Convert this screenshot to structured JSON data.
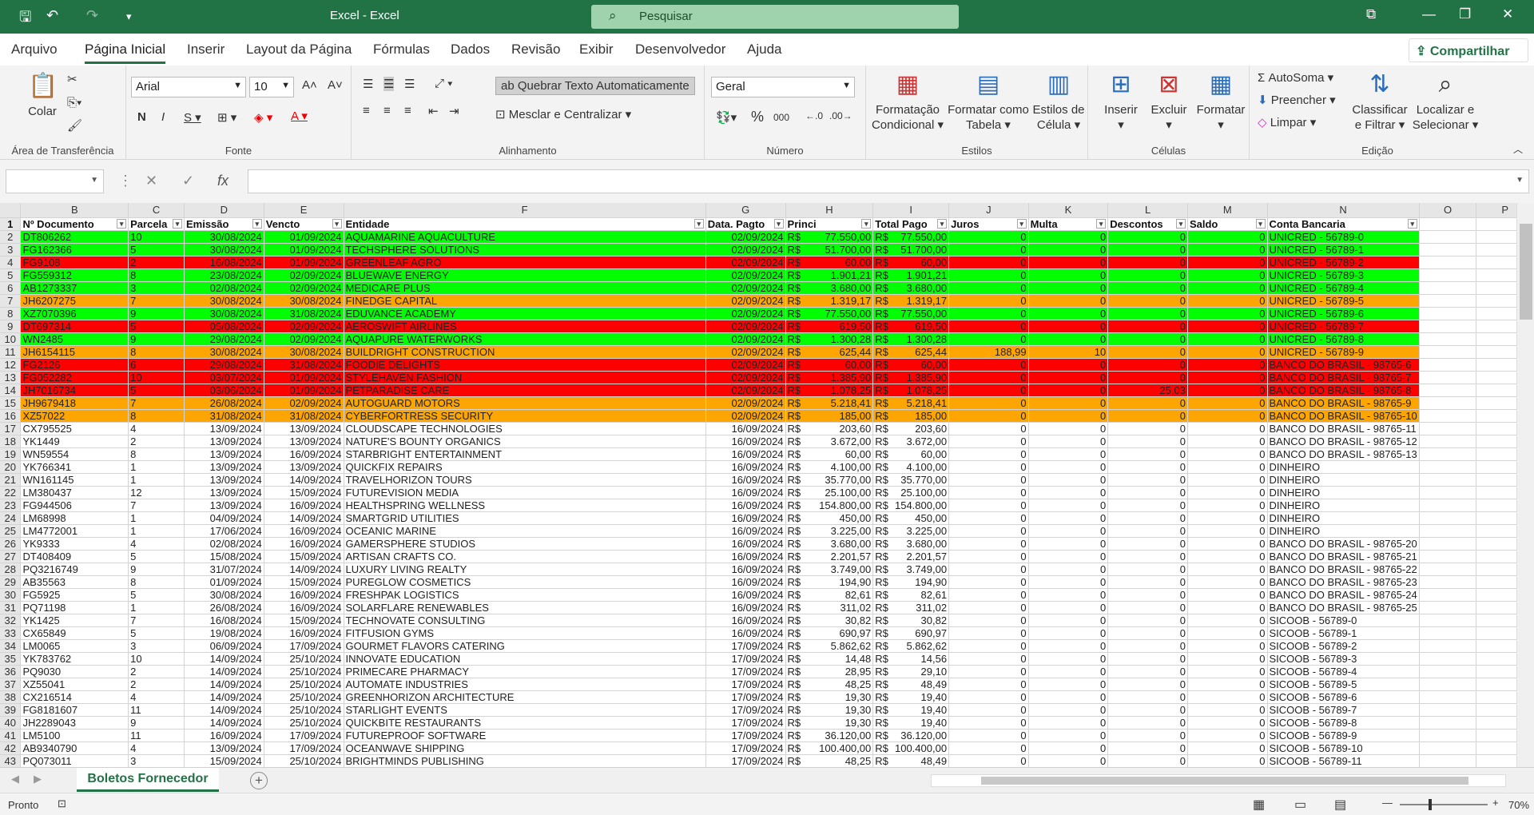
{
  "titlebar": {
    "title": "Excel  -  Excel",
    "search_placeholder": "Pesquisar"
  },
  "menu": {
    "tabs": [
      "Arquivo",
      "Página Inicial",
      "Inserir",
      "Layout da Página",
      "Fórmulas",
      "Dados",
      "Revisão",
      "Exibir",
      "Desenvolvedor",
      "Ajuda"
    ],
    "share": "Compartilhar"
  },
  "ribbon": {
    "clipboard": {
      "label": "Área de Transferência",
      "paste": "Colar"
    },
    "font": {
      "label": "Fonte",
      "name": "Arial",
      "size": "10"
    },
    "alignment": {
      "label": "Alinhamento",
      "wrap": "Quebrar Texto Automaticamente",
      "merge": "Mesclar e Centralizar"
    },
    "number": {
      "label": "Número",
      "format": "Geral"
    },
    "styles": {
      "label": "Estilos",
      "cond1": "Formatação",
      "cond2": "Condicional",
      "table1": "Formatar como",
      "table2": "Tabela",
      "cell1": "Estilos de",
      "cell2": "Célula"
    },
    "cells": {
      "label": "Células",
      "insert": "Inserir",
      "delete": "Excluir",
      "format": "Formatar"
    },
    "editing": {
      "label": "Edição",
      "autosum": "AutoSoma",
      "fill": "Preencher",
      "clear": "Limpar",
      "sort1": "Classificar",
      "sort2": "e Filtrar",
      "find1": "Localizar e",
      "find2": "Selecionar"
    }
  },
  "grid": {
    "columns": [
      "",
      "B",
      "C",
      "D",
      "E",
      "F",
      "G",
      "H",
      "I",
      "J",
      "K",
      "L",
      "M",
      "N",
      "O",
      "P"
    ],
    "headers": [
      "Nº Documento",
      "Parcela",
      "Emissão",
      "Vencto",
      "Entidade",
      "Data. Pagto",
      "Princi",
      "Total Pago",
      "Juros",
      "Multa",
      "Descontos",
      "Saldo",
      "Conta Bancaria",
      "",
      ""
    ],
    "rows": [
      {
        "n": "2",
        "c": "green",
        "d": [
          "DT806262",
          "10",
          "30/08/2024",
          "01/09/2024",
          "AQUAMARINE AQUACULTURE",
          "02/09/2024",
          "77.550,00",
          "77.550,00",
          "0",
          "0",
          "0",
          "0",
          "UNICRED - 56789-0"
        ]
      },
      {
        "n": "3",
        "c": "green",
        "d": [
          "FG162366",
          "5",
          "30/08/2024",
          "01/09/2024",
          "TECHSPHERE SOLUTIONS",
          "02/09/2024",
          "51.700,00",
          "51.700,00",
          "0",
          "0",
          "0",
          "0",
          "UNICRED - 56789-1"
        ]
      },
      {
        "n": "4",
        "c": "red",
        "d": [
          "FG9108",
          "2",
          "16/08/2024",
          "01/09/2024",
          "GREENLEAF AGRO",
          "02/09/2024",
          "60,00",
          "60,00",
          "0",
          "0",
          "0",
          "0",
          "UNICRED - 56789-2"
        ]
      },
      {
        "n": "5",
        "c": "green",
        "d": [
          "FG559312",
          "8",
          "23/08/2024",
          "02/09/2024",
          "BLUEWAVE ENERGY",
          "02/09/2024",
          "1.901,21",
          "1.901,21",
          "0",
          "0",
          "0",
          "0",
          "UNICRED - 56789-3"
        ]
      },
      {
        "n": "6",
        "c": "green",
        "d": [
          "AB1273337",
          "3",
          "02/08/2024",
          "02/09/2024",
          "MEDICARE PLUS",
          "02/09/2024",
          "3.680,00",
          "3.680,00",
          "0",
          "0",
          "0",
          "0",
          "UNICRED - 56789-4"
        ]
      },
      {
        "n": "7",
        "c": "orange",
        "d": [
          "JH6207275",
          "7",
          "30/08/2024",
          "30/08/2024",
          "FINEDGE CAPITAL",
          "02/09/2024",
          "1.319,17",
          "1.319,17",
          "0",
          "0",
          "0",
          "0",
          "UNICRED - 56789-5"
        ]
      },
      {
        "n": "8",
        "c": "green",
        "d": [
          "XZ7070396",
          "9",
          "30/08/2024",
          "31/08/2024",
          "EDUVANCE ACADEMY",
          "02/09/2024",
          "77.550,00",
          "77.550,00",
          "0",
          "0",
          "0",
          "0",
          "UNICRED - 56789-6"
        ]
      },
      {
        "n": "9",
        "c": "red",
        "d": [
          "DT697314",
          "5",
          "05/08/2024",
          "02/09/2024",
          "AEROSWIFT AIRLINES",
          "02/09/2024",
          "619,50",
          "619,50",
          "0",
          "0",
          "0",
          "0",
          "UNICRED - 56789-7"
        ]
      },
      {
        "n": "10",
        "c": "green",
        "d": [
          "WN2485",
          "9",
          "29/08/2024",
          "02/09/2024",
          "AQUAPURE WATERWORKS",
          "02/09/2024",
          "1.300,28",
          "1.300,28",
          "0",
          "0",
          "0",
          "0",
          "UNICRED - 56789-8"
        ]
      },
      {
        "n": "11",
        "c": "orange",
        "d": [
          "JH6154115",
          "8",
          "30/08/2024",
          "30/08/2024",
          "BUILDRIGHT CONSTRUCTION",
          "02/09/2024",
          "625,44",
          "625,44",
          "188,99",
          "10",
          "0",
          "0",
          "UNICRED - 56789-9"
        ]
      },
      {
        "n": "12",
        "c": "red",
        "d": [
          "FG2126",
          "6",
          "29/08/2024",
          "31/08/2024",
          "FOODIE DELIGHTS",
          "02/09/2024",
          "60,00",
          "60,00",
          "0",
          "0",
          "0",
          "0",
          "BANCO DO BRASIL - 98765-6"
        ]
      },
      {
        "n": "13",
        "c": "red",
        "d": [
          "FG052282",
          "10",
          "03/07/2024",
          "01/09/2024",
          "STYLEHAVEN FASHION",
          "02/09/2024",
          "1.385,90",
          "1.385,90",
          "0",
          "0",
          "0",
          "0",
          "BANCO DO BRASIL - 98765-7"
        ]
      },
      {
        "n": "14",
        "c": "red",
        "d": [
          "JH7016734",
          "5",
          "03/06/2024",
          "01/09/2024",
          "PETPARADISE CARE",
          "02/09/2024",
          "1.078,25",
          "1.078,25",
          "0",
          "0",
          "25,03",
          "0",
          "BANCO DO BRASIL - 98765-8"
        ]
      },
      {
        "n": "15",
        "c": "orange",
        "d": [
          "JH9679418",
          "7",
          "26/08/2024",
          "02/09/2024",
          "AUTOGUARD MOTORS",
          "02/09/2024",
          "5.218,41",
          "5.218,41",
          "0",
          "0",
          "0",
          "0",
          "BANCO DO BRASIL - 98765-9"
        ]
      },
      {
        "n": "16",
        "c": "orange",
        "d": [
          "XZ57022",
          "8",
          "31/08/2024",
          "31/08/2024",
          "CYBERFORTRESS SECURITY",
          "02/09/2024",
          "185,00",
          "185,00",
          "0",
          "0",
          "0",
          "0",
          "BANCO DO BRASIL - 98765-10"
        ]
      },
      {
        "n": "17",
        "c": "",
        "d": [
          "CX795525",
          "4",
          "13/09/2024",
          "13/09/2024",
          "CLOUDSCAPE TECHNOLOGIES",
          "16/09/2024",
          "203,60",
          "203,60",
          "0",
          "0",
          "0",
          "0",
          "BANCO DO BRASIL - 98765-11"
        ]
      },
      {
        "n": "18",
        "c": "",
        "d": [
          "YK1449",
          "2",
          "13/09/2024",
          "13/09/2024",
          "NATURE'S BOUNTY ORGANICS",
          "16/09/2024",
          "3.672,00",
          "3.672,00",
          "0",
          "0",
          "0",
          "0",
          "BANCO DO BRASIL - 98765-12"
        ]
      },
      {
        "n": "19",
        "c": "",
        "d": [
          "WN59554",
          "8",
          "13/09/2024",
          "16/09/2024",
          "STARBRIGHT ENTERTAINMENT",
          "16/09/2024",
          "60,00",
          "60,00",
          "0",
          "0",
          "0",
          "0",
          "BANCO DO BRASIL - 98765-13"
        ]
      },
      {
        "n": "20",
        "c": "",
        "d": [
          "YK766341",
          "1",
          "13/09/2024",
          "13/09/2024",
          "QUICKFIX REPAIRS",
          "16/09/2024",
          "4.100,00",
          "4.100,00",
          "0",
          "0",
          "0",
          "0",
          "DINHEIRO"
        ]
      },
      {
        "n": "21",
        "c": "",
        "d": [
          "WN161145",
          "1",
          "13/09/2024",
          "14/09/2024",
          "TRAVELHORIZON TOURS",
          "16/09/2024",
          "35.770,00",
          "35.770,00",
          "0",
          "0",
          "0",
          "0",
          "DINHEIRO"
        ]
      },
      {
        "n": "22",
        "c": "",
        "d": [
          "LM380437",
          "12",
          "13/09/2024",
          "15/09/2024",
          "FUTUREVISION MEDIA",
          "16/09/2024",
          "25.100,00",
          "25.100,00",
          "0",
          "0",
          "0",
          "0",
          "DINHEIRO"
        ]
      },
      {
        "n": "23",
        "c": "",
        "d": [
          "FG944506",
          "7",
          "13/09/2024",
          "16/09/2024",
          "HEALTHSPRING WELLNESS",
          "16/09/2024",
          "154.800,00",
          "154.800,00",
          "0",
          "0",
          "0",
          "0",
          "DINHEIRO"
        ]
      },
      {
        "n": "24",
        "c": "",
        "d": [
          "LM68998",
          "1",
          "04/09/2024",
          "14/09/2024",
          "SMARTGRID UTILITIES",
          "16/09/2024",
          "450,00",
          "450,00",
          "0",
          "0",
          "0",
          "0",
          "DINHEIRO"
        ]
      },
      {
        "n": "25",
        "c": "",
        "d": [
          "LM4772001",
          "1",
          "17/06/2024",
          "16/09/2024",
          "OCEANIC MARINE",
          "16/09/2024",
          "3.225,00",
          "3.225,00",
          "0",
          "0",
          "0",
          "0",
          "DINHEIRO"
        ]
      },
      {
        "n": "26",
        "c": "",
        "d": [
          "YK9333",
          "4",
          "02/08/2024",
          "16/09/2024",
          "GAMERSPHERE STUDIOS",
          "16/09/2024",
          "3.680,00",
          "3.680,00",
          "0",
          "0",
          "0",
          "0",
          "BANCO DO BRASIL - 98765-20"
        ]
      },
      {
        "n": "27",
        "c": "",
        "d": [
          "DT408409",
          "5",
          "15/08/2024",
          "15/09/2024",
          "ARTISAN CRAFTS CO.",
          "16/09/2024",
          "2.201,57",
          "2.201,57",
          "0",
          "0",
          "0",
          "0",
          "BANCO DO BRASIL - 98765-21"
        ]
      },
      {
        "n": "28",
        "c": "",
        "d": [
          "PQ3216749",
          "9",
          "31/07/2024",
          "14/09/2024",
          "LUXURY LIVING REALTY",
          "16/09/2024",
          "3.749,00",
          "3.749,00",
          "0",
          "0",
          "0",
          "0",
          "BANCO DO BRASIL - 98765-22"
        ]
      },
      {
        "n": "29",
        "c": "",
        "d": [
          "AB35563",
          "8",
          "01/09/2024",
          "15/09/2024",
          "PUREGLOW COSMETICS",
          "16/09/2024",
          "194,90",
          "194,90",
          "0",
          "0",
          "0",
          "0",
          "BANCO DO BRASIL - 98765-23"
        ]
      },
      {
        "n": "30",
        "c": "",
        "d": [
          "FG5925",
          "5",
          "30/08/2024",
          "16/09/2024",
          "FRESHPAK LOGISTICS",
          "16/09/2024",
          "82,61",
          "82,61",
          "0",
          "0",
          "0",
          "0",
          "BANCO DO BRASIL - 98765-24"
        ]
      },
      {
        "n": "31",
        "c": "",
        "d": [
          "PQ71198",
          "1",
          "26/08/2024",
          "16/09/2024",
          "SOLARFLARE RENEWABLES",
          "16/09/2024",
          "311,02",
          "311,02",
          "0",
          "0",
          "0",
          "0",
          "BANCO DO BRASIL - 98765-25"
        ]
      },
      {
        "n": "32",
        "c": "",
        "d": [
          "YK1425",
          "7",
          "16/08/2024",
          "15/09/2024",
          "TECHNOVATE CONSULTING",
          "16/09/2024",
          "30,82",
          "30,82",
          "0",
          "0",
          "0",
          "0",
          "SICOOB - 56789-0"
        ]
      },
      {
        "n": "33",
        "c": "",
        "d": [
          "CX65849",
          "5",
          "19/08/2024",
          "16/09/2024",
          "FITFUSION GYMS",
          "16/09/2024",
          "690,97",
          "690,97",
          "0",
          "0",
          "0",
          "0",
          "SICOOB - 56789-1"
        ]
      },
      {
        "n": "34",
        "c": "",
        "d": [
          "LM0065",
          "3",
          "06/09/2024",
          "17/09/2024",
          "GOURMET FLAVORS CATERING",
          "17/09/2024",
          "5.862,62",
          "5.862,62",
          "0",
          "0",
          "0",
          "0",
          "SICOOB - 56789-2"
        ]
      },
      {
        "n": "35",
        "c": "",
        "d": [
          "YK783762",
          "10",
          "14/09/2024",
          "25/10/2024",
          "INNOVATE EDUCATION",
          "17/09/2024",
          "14,48",
          "14,56",
          "0",
          "0",
          "0",
          "0",
          "SICOOB - 56789-3"
        ]
      },
      {
        "n": "36",
        "c": "",
        "d": [
          "PQ9030",
          "2",
          "14/09/2024",
          "25/10/2024",
          "PRIMECARE PHARMACY",
          "17/09/2024",
          "28,95",
          "29,10",
          "0",
          "0",
          "0",
          "0",
          "SICOOB - 56789-4"
        ]
      },
      {
        "n": "37",
        "c": "",
        "d": [
          "XZ55041",
          "2",
          "14/09/2024",
          "25/10/2024",
          "AUTOMATE INDUSTRIES",
          "17/09/2024",
          "48,25",
          "48,49",
          "0",
          "0",
          "0",
          "0",
          "SICOOB - 56789-5"
        ]
      },
      {
        "n": "38",
        "c": "",
        "d": [
          "CX216514",
          "4",
          "14/09/2024",
          "25/10/2024",
          "GREENHORIZON ARCHITECTURE",
          "17/09/2024",
          "19,30",
          "19,40",
          "0",
          "0",
          "0",
          "0",
          "SICOOB - 56789-6"
        ]
      },
      {
        "n": "39",
        "c": "",
        "d": [
          "FG8181607",
          "11",
          "14/09/2024",
          "25/10/2024",
          "STARLIGHT EVENTS",
          "17/09/2024",
          "19,30",
          "19,40",
          "0",
          "0",
          "0",
          "0",
          "SICOOB - 56789-7"
        ]
      },
      {
        "n": "40",
        "c": "",
        "d": [
          "JH2289043",
          "9",
          "14/09/2024",
          "25/10/2024",
          "QUICKBITE RESTAURANTS",
          "17/09/2024",
          "19,30",
          "19,40",
          "0",
          "0",
          "0",
          "0",
          "SICOOB - 56789-8"
        ]
      },
      {
        "n": "41",
        "c": "",
        "d": [
          "LM5100",
          "11",
          "16/09/2024",
          "17/09/2024",
          "FUTUREPROOF SOFTWARE",
          "17/09/2024",
          "36.120,00",
          "36.120,00",
          "0",
          "0",
          "0",
          "0",
          "SICOOB - 56789-9"
        ]
      },
      {
        "n": "42",
        "c": "",
        "d": [
          "AB9340790",
          "4",
          "13/09/2024",
          "17/09/2024",
          "OCEANWAVE SHIPPING",
          "17/09/2024",
          "100.400,00",
          "100.400,00",
          "0",
          "0",
          "0",
          "0",
          "SICOOB - 56789-10"
        ]
      },
      {
        "n": "43",
        "c": "",
        "d": [
          "PQ073011",
          "3",
          "15/09/2024",
          "25/10/2024",
          "BRIGHTMINDS PUBLISHING",
          "17/09/2024",
          "48,25",
          "48,49",
          "0",
          "0",
          "0",
          "0",
          "SICOOB - 56789-11"
        ]
      }
    ],
    "currency": "R$"
  },
  "sheettab": "Boletos Fornecedor",
  "status": {
    "ready": "Pronto",
    "zoom": "70%"
  }
}
